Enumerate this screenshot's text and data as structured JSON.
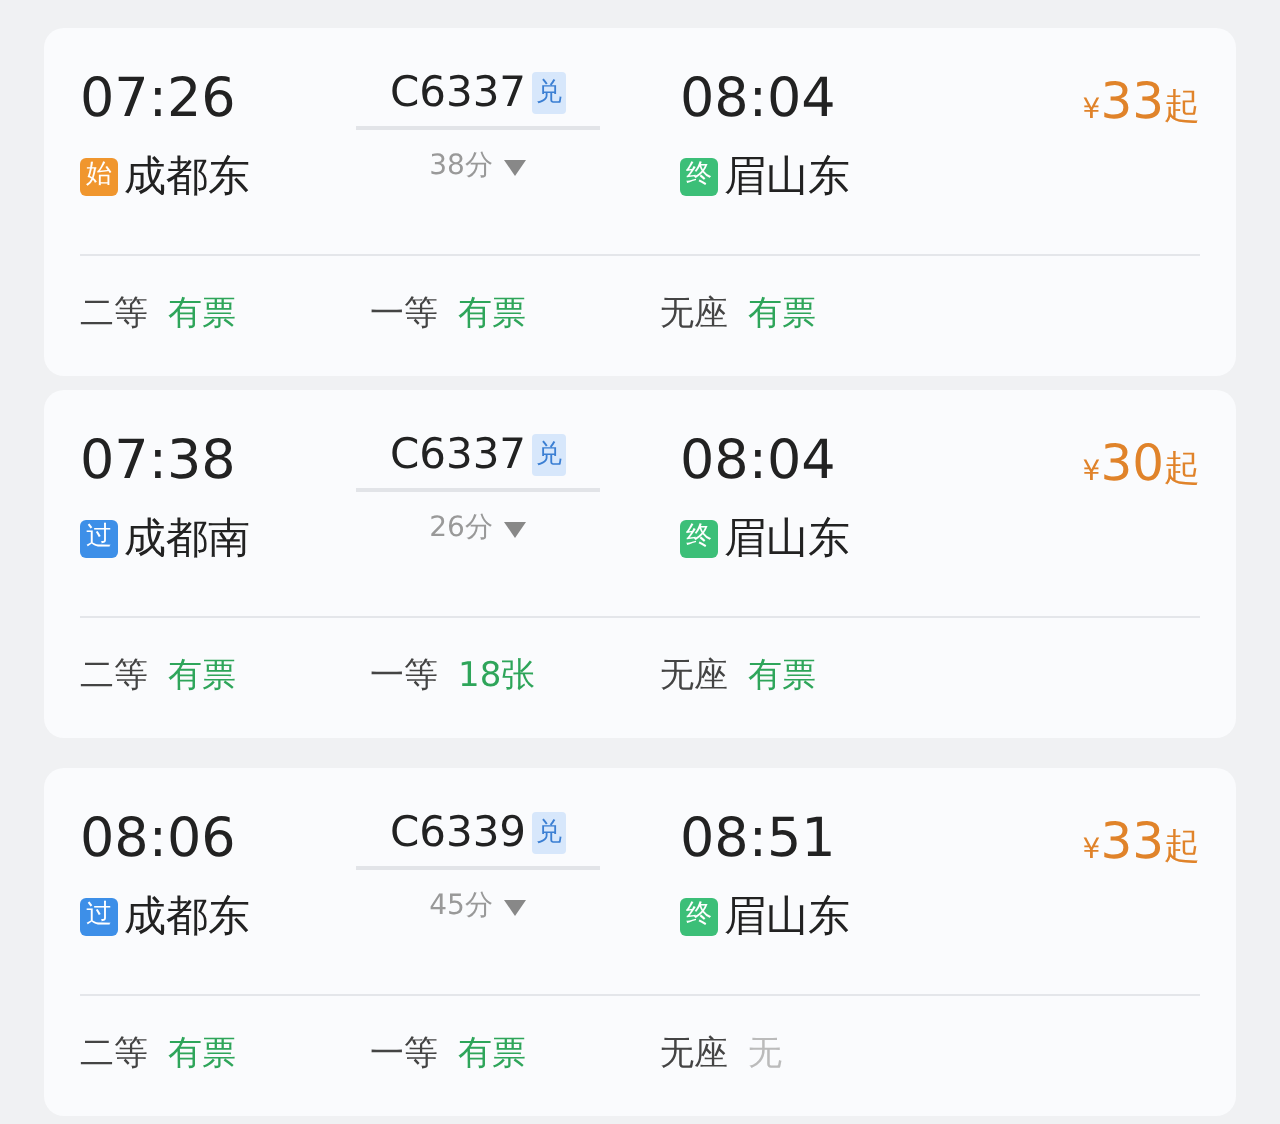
{
  "trains": [
    {
      "depart_time": "07:26",
      "train_no": "C6337",
      "exchange_tag": "兑",
      "arrive_time": "08:04",
      "price": {
        "currency": "¥",
        "amount": "33",
        "suffix": "起"
      },
      "from": {
        "tag": "始",
        "color": "#f0962e",
        "name": "成都东"
      },
      "duration": "38分",
      "to": {
        "tag": "终",
        "color": "#3cbf78",
        "name": "眉山东"
      },
      "seats": [
        {
          "class": "二等",
          "status": "有票",
          "available": true
        },
        {
          "class": "一等",
          "status": "有票",
          "available": true
        },
        {
          "class": "无座",
          "status": "有票",
          "available": true
        }
      ]
    },
    {
      "depart_time": "07:38",
      "train_no": "C6337",
      "exchange_tag": "兑",
      "arrive_time": "08:04",
      "price": {
        "currency": "¥",
        "amount": "30",
        "suffix": "起"
      },
      "from": {
        "tag": "过",
        "color": "#3d8fe8",
        "name": "成都南"
      },
      "duration": "26分",
      "to": {
        "tag": "终",
        "color": "#3cbf78",
        "name": "眉山东"
      },
      "seats": [
        {
          "class": "二等",
          "status": "有票",
          "available": true
        },
        {
          "class": "一等",
          "status": "18张",
          "available": true
        },
        {
          "class": "无座",
          "status": "有票",
          "available": true
        }
      ]
    },
    {
      "depart_time": "08:06",
      "train_no": "C6339",
      "exchange_tag": "兑",
      "arrive_time": "08:51",
      "price": {
        "currency": "¥",
        "amount": "33",
        "suffix": "起"
      },
      "from": {
        "tag": "过",
        "color": "#3d8fe8",
        "name": "成都东"
      },
      "duration": "45分",
      "to": {
        "tag": "终",
        "color": "#3cbf78",
        "name": "眉山东"
      },
      "seats": [
        {
          "class": "二等",
          "status": "有票",
          "available": true
        },
        {
          "class": "一等",
          "status": "有票",
          "available": true
        },
        {
          "class": "无座",
          "status": "无",
          "available": false
        }
      ]
    }
  ]
}
